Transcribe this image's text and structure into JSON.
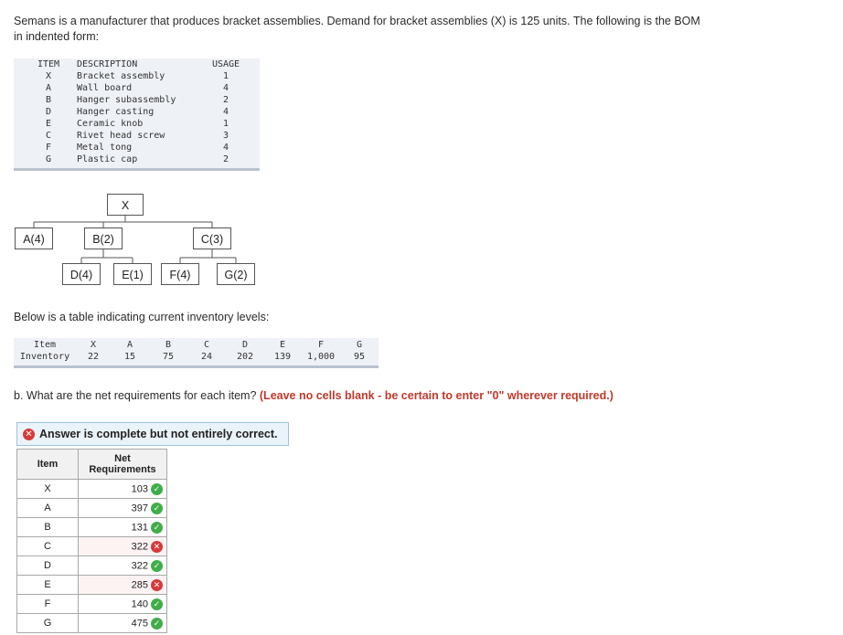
{
  "intro": {
    "line1": "Semans is a manufacturer that produces bracket assemblies. Demand for bracket assemblies (X) is 125 units. The following is the BOM",
    "line2": "in indented form:"
  },
  "bom": {
    "headers": {
      "item": "ITEM",
      "description": "DESCRIPTION",
      "usage": "USAGE"
    },
    "rows": [
      {
        "item": "X",
        "description": "Bracket assembly",
        "usage": "1"
      },
      {
        "item": "A",
        "description": "Wall board",
        "usage": "4"
      },
      {
        "item": "B",
        "description": "Hanger subassembly",
        "usage": "2"
      },
      {
        "item": "D",
        "description": "Hanger casting",
        "usage": "4"
      },
      {
        "item": "E",
        "description": "Ceramic knob",
        "usage": "1"
      },
      {
        "item": "C",
        "description": "Rivet head screw",
        "usage": "3"
      },
      {
        "item": "F",
        "description": "Metal tong",
        "usage": "4"
      },
      {
        "item": "G",
        "description": "Plastic cap",
        "usage": "2"
      }
    ]
  },
  "tree": {
    "root": "X",
    "level1": [
      "A(4)",
      "B(2)",
      "C(3)"
    ],
    "level2": [
      "D(4)",
      "E(1)",
      "F(4)",
      "G(2)"
    ]
  },
  "below_text": "Below is a table indicating current inventory levels:",
  "inventory": {
    "label_item": "Item",
    "label_inventory": "Inventory",
    "items": [
      "X",
      "A",
      "B",
      "C",
      "D",
      "E",
      "F",
      "G"
    ],
    "values": [
      "22",
      "15",
      "75",
      "24",
      "202",
      "139",
      "1,000",
      "95"
    ]
  },
  "question": {
    "text": "b. What are the net requirements for each item? ",
    "emphasis": "(Leave no cells blank - be certain to enter \"0\" wherever required.)"
  },
  "banner": {
    "text": "Answer is complete but not entirely correct.",
    "icon": "x-circle-icon"
  },
  "answer_table": {
    "header_item": "Item",
    "header_net_1": "Net",
    "header_net_2": "Requirements",
    "rows": [
      {
        "item": "X",
        "net": "103",
        "status": "correct"
      },
      {
        "item": "A",
        "net": "397",
        "status": "correct"
      },
      {
        "item": "B",
        "net": "131",
        "status": "correct"
      },
      {
        "item": "C",
        "net": "322",
        "status": "incorrect"
      },
      {
        "item": "D",
        "net": "322",
        "status": "correct"
      },
      {
        "item": "E",
        "net": "285",
        "status": "incorrect"
      },
      {
        "item": "F",
        "net": "140",
        "status": "correct"
      },
      {
        "item": "G",
        "net": "475",
        "status": "correct"
      }
    ]
  },
  "colors": {
    "correct": "#3fae49",
    "incorrect": "#d63a3a",
    "emphasis": "#c0392b"
  }
}
